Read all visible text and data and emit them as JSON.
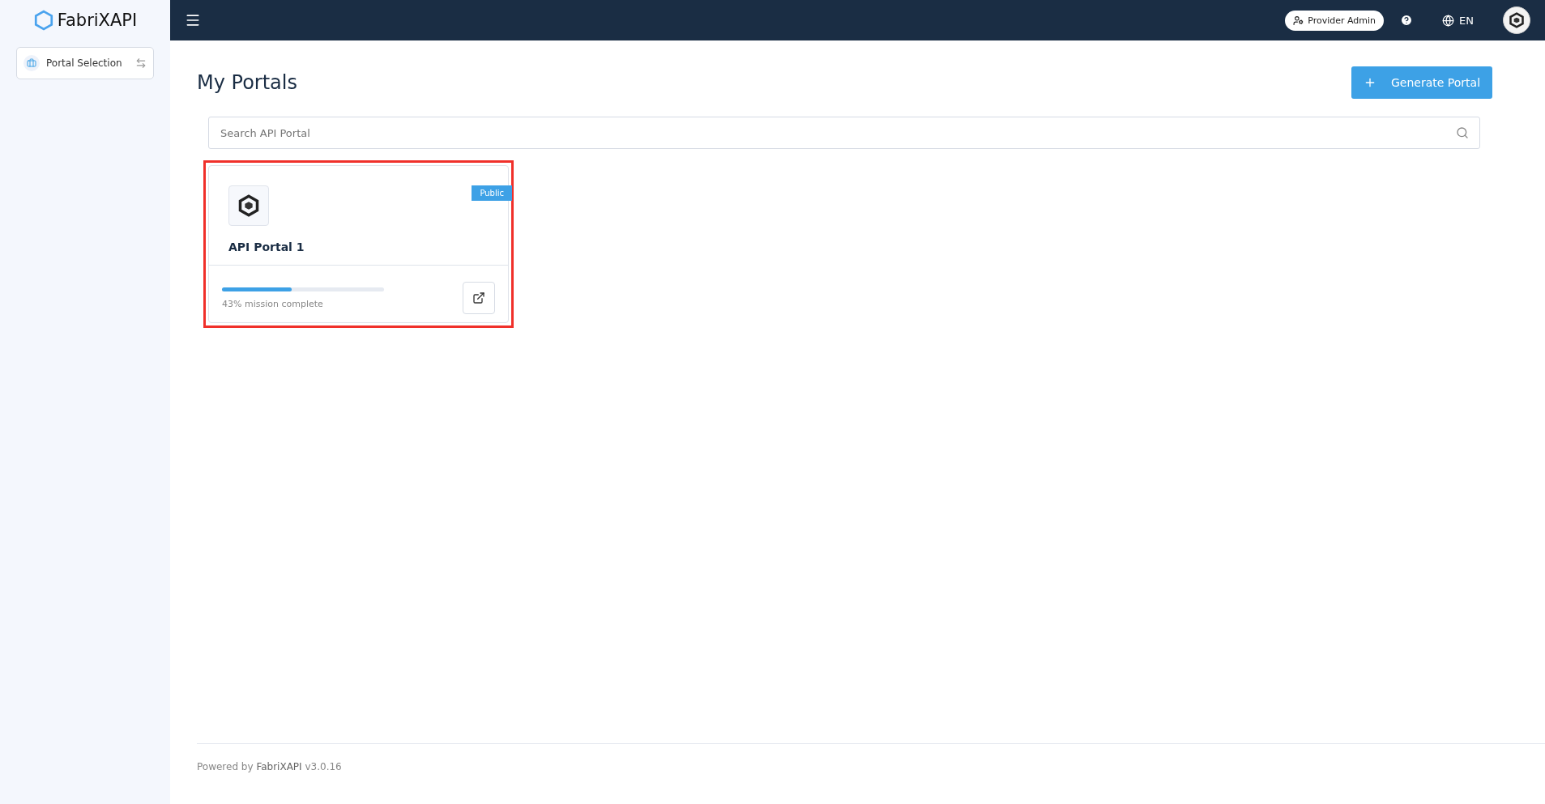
{
  "sidebar": {
    "brand": "FabriXAPI",
    "items": [
      {
        "label": "Portal Selection",
        "selected": true
      }
    ]
  },
  "topbar": {
    "role": "Provider Admin",
    "language": "EN"
  },
  "page": {
    "title": "My Portals",
    "action": "Generate Portal",
    "search": {
      "placeholder": "Search API Portal"
    }
  },
  "portals": [
    {
      "name": "API Portal 1",
      "badge": "Public",
      "level": 0.43,
      "progress_text": "43% mission complete",
      "highlighted": true
    }
  ],
  "footer": {
    "text": "Powered by **FabriXAPI** v3.0.16"
  }
}
